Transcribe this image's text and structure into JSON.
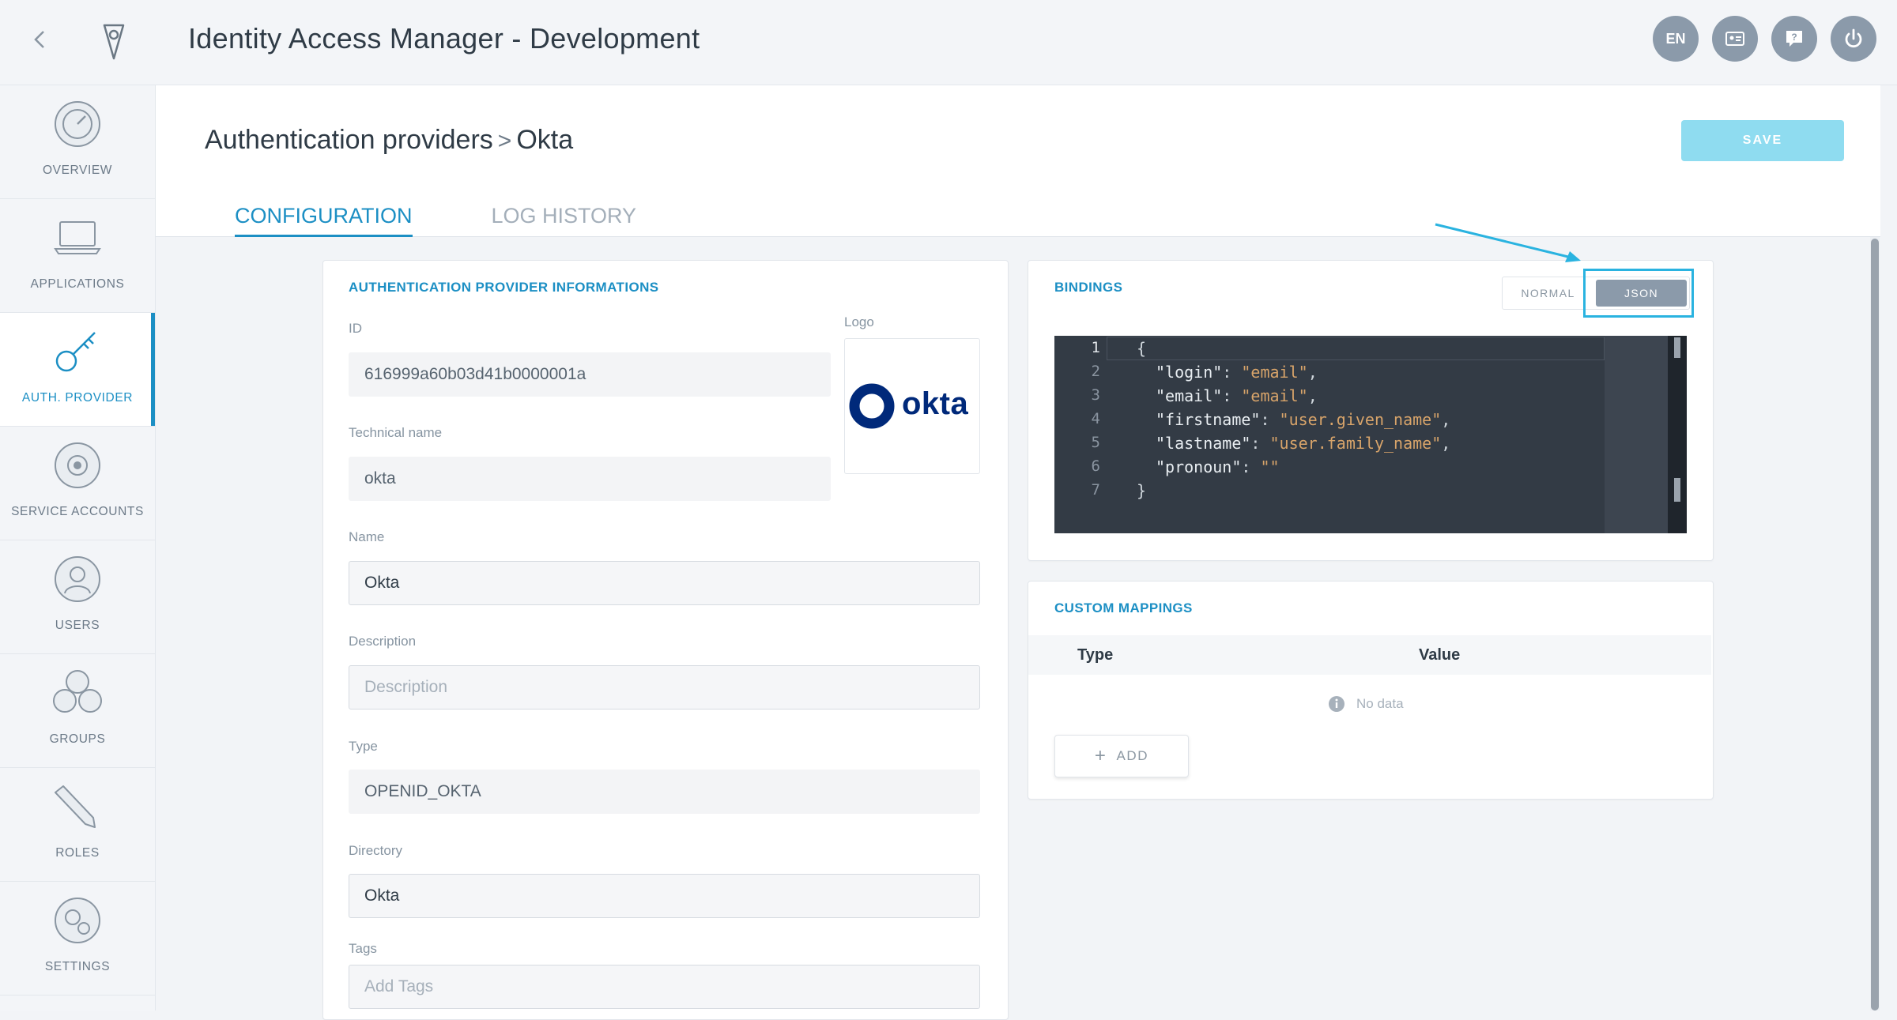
{
  "header": {
    "title": "Identity Access Manager - Development",
    "actions": [
      {
        "name": "language-button",
        "label": "EN"
      },
      {
        "name": "profile-card-button",
        "label": ""
      },
      {
        "name": "help-button",
        "label": ""
      },
      {
        "name": "logout-button",
        "label": ""
      }
    ]
  },
  "sidebar": {
    "items": [
      {
        "label": "OVERVIEW",
        "icon": "gauge-icon"
      },
      {
        "label": "APPLICATIONS",
        "icon": "laptop-icon"
      },
      {
        "label": "AUTH. PROVIDER",
        "icon": "key-icon",
        "active": true
      },
      {
        "label": "SERVICE ACCOUNTS",
        "icon": "gear-users-icon"
      },
      {
        "label": "USERS",
        "icon": "user-icon"
      },
      {
        "label": "GROUPS",
        "icon": "group-icon"
      },
      {
        "label": "ROLES",
        "icon": "pencil-icon"
      },
      {
        "label": "SETTINGS",
        "icon": "gears-icon"
      }
    ]
  },
  "page": {
    "breadcrumb_parent": "Authentication providers",
    "breadcrumb_sep": ">",
    "breadcrumb_current": "Okta",
    "save_label": "SAVE",
    "tabs": [
      "CONFIGURATION",
      "LOG HISTORY"
    ]
  },
  "info_card": {
    "title": "AUTHENTICATION PROVIDER INFORMATIONS",
    "id_label": "ID",
    "id_value": "616999a60b03d41b0000001a",
    "logo_label": "Logo",
    "logo_text": "okta",
    "technical_name_label": "Technical name",
    "technical_name_value": "okta",
    "name_label": "Name",
    "name_value": "Okta",
    "description_label": "Description",
    "description_placeholder": "Description",
    "type_label": "Type",
    "type_value": "OPENID_OKTA",
    "directory_label": "Directory",
    "directory_value": "Okta",
    "tags_label": "Tags",
    "tags_placeholder": "Add Tags"
  },
  "bindings": {
    "title": "BINDINGS",
    "mode_normal": "NORMAL",
    "mode_json": "JSON",
    "selected_mode": "JSON",
    "lines": [
      {
        "n": "1",
        "key": "",
        "value": "",
        "text": "{"
      },
      {
        "n": "2",
        "key": "\"login\"",
        "value": "\"email\"",
        "text": ","
      },
      {
        "n": "3",
        "key": "\"email\"",
        "value": "\"email\"",
        "text": ","
      },
      {
        "n": "4",
        "key": "\"firstname\"",
        "value": "\"user.given_name\"",
        "text": ","
      },
      {
        "n": "5",
        "key": "\"lastname\"",
        "value": "\"user.family_name\"",
        "text": ","
      },
      {
        "n": "6",
        "key": "\"pronoun\"",
        "value": "\"\"",
        "text": ""
      },
      {
        "n": "7",
        "key": "",
        "value": "",
        "text": "}"
      }
    ]
  },
  "custom_mappings": {
    "title": "CUSTOM MAPPINGS",
    "columns": [
      "Type",
      "Value"
    ],
    "empty_text": "No data",
    "add_label": "ADD"
  },
  "colors": {
    "accent": "#1c8fc4",
    "save_disabled": "#8fdcf0",
    "highlight": "#2ab3e0",
    "okta_blue": "#00297a"
  }
}
